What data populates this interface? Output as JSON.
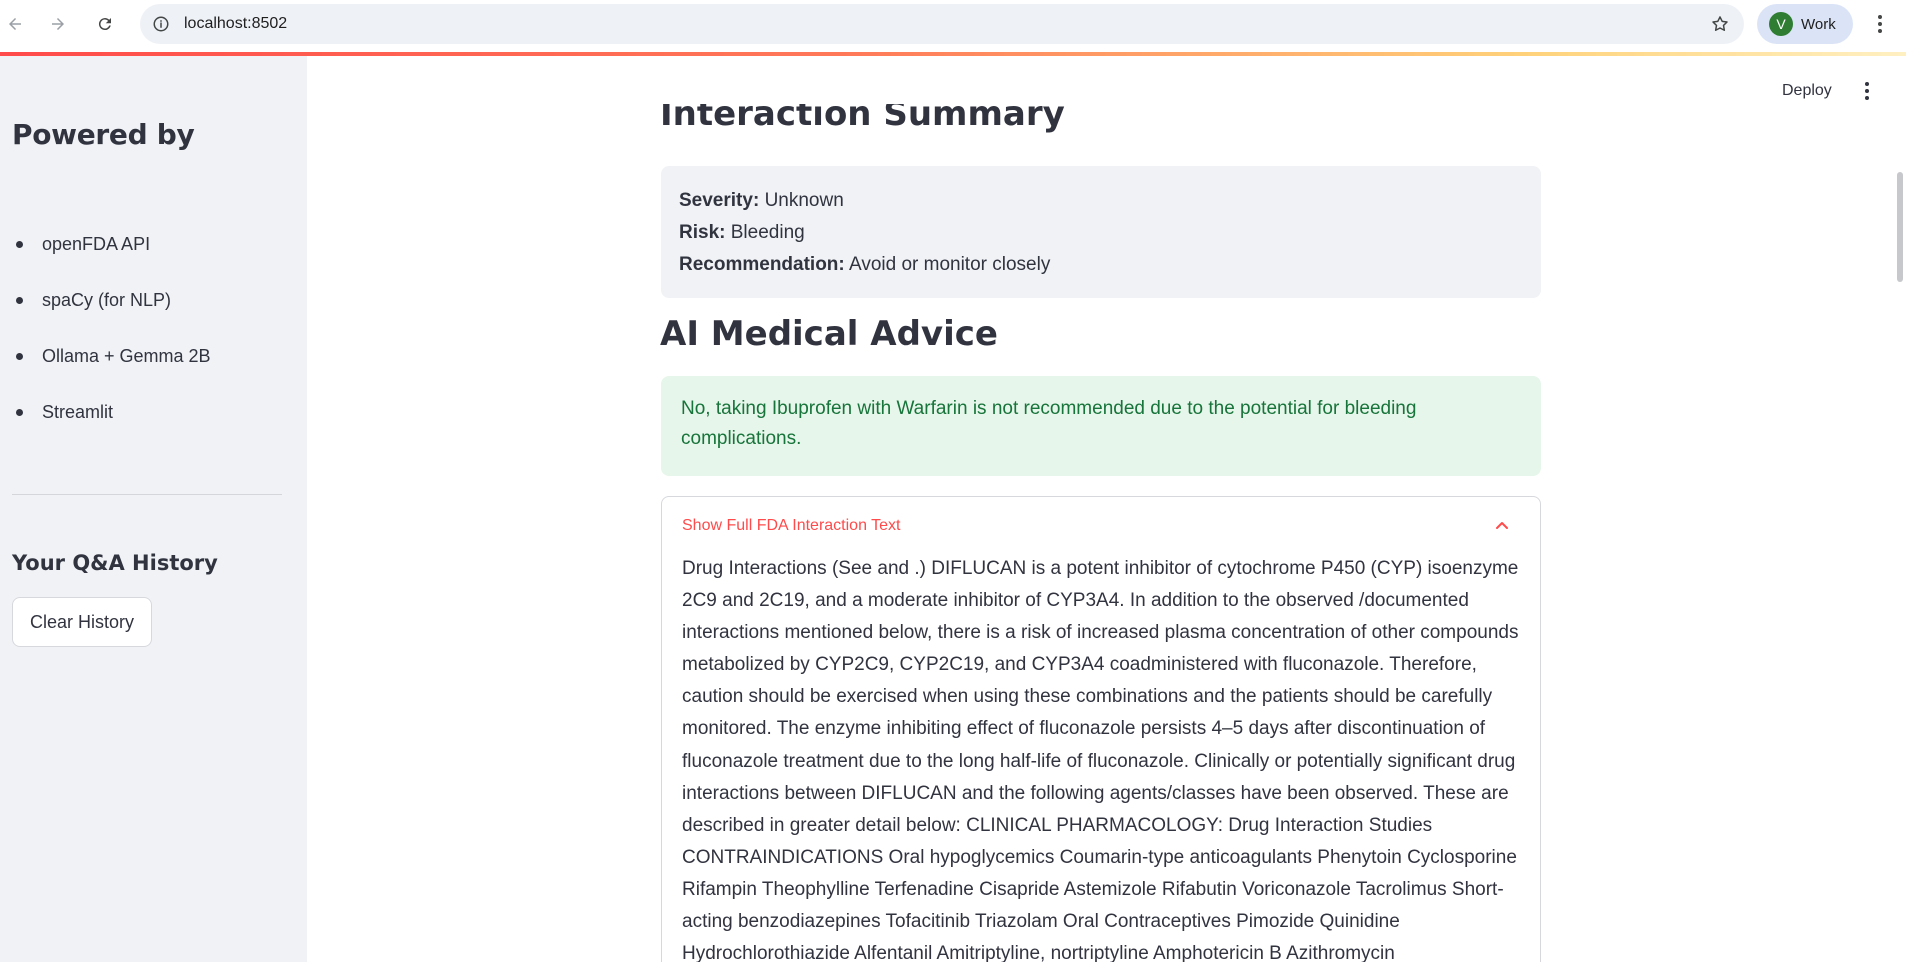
{
  "browser": {
    "url": "localhost:8502",
    "profile_initial": "V",
    "profile_label": "Work"
  },
  "header": {
    "deploy_label": "Deploy"
  },
  "sidebar": {
    "powered_title": "Powered by",
    "powered_items": [
      "openFDA API",
      "spaCy (for NLP)",
      "Ollama + Gemma 2B",
      "Streamlit"
    ],
    "history_title": "Your Q&A History",
    "clear_history_label": "Clear History"
  },
  "main": {
    "summary_heading": "Interaction Summary",
    "summary": {
      "severity_label": "Severity:",
      "severity_value": "Unknown",
      "risk_label": "Risk:",
      "risk_value": "Bleeding",
      "recommendation_label": "Recommendation:",
      "recommendation_value": "Avoid or monitor closely"
    },
    "advice_heading": "AI Medical Advice",
    "advice_text": "No, taking Ibuprofen with Warfarin is not recommended due to the potential for bleeding complications.",
    "expander_label": "Show Full FDA Interaction Text",
    "fda_text": "Drug Interactions (See and .) DIFLUCAN is a potent inhibitor of cytochrome P450 (CYP) isoenzyme 2C9 and 2C19, and a moderate inhibitor of CYP3A4. In addition to the observed /documented interactions mentioned below, there is a risk of increased plasma concentration of other compounds metabolized by CYP2C9, CYP2C19, and CYP3A4 coadministered with fluconazole. Therefore, caution should be exercised when using these combinations and the patients should be carefully monitored. The enzyme inhibiting effect of fluconazole persists 4–5 days after discontinuation of fluconazole treatment due to the long half-life of fluconazole. Clinically or potentially significant drug interactions between DIFLUCAN and the following agents/classes have been observed. These are described in greater detail below: CLINICAL PHARMACOLOGY: Drug Interaction Studies CONTRAINDICATIONS Oral hypoglycemics Coumarin-type anticoagulants Phenytoin Cyclosporine Rifampin Theophylline Terfenadine Cisapride Astemizole Rifabutin Voriconazole Tacrolimus Short-acting benzodiazepines Tofacitinib Triazolam Oral Contraceptives Pimozide Quinidine Hydrochlorothiazide Alfentanil Amitriptyline, nortriptyline Amphotericin B Azithromycin"
  }
}
